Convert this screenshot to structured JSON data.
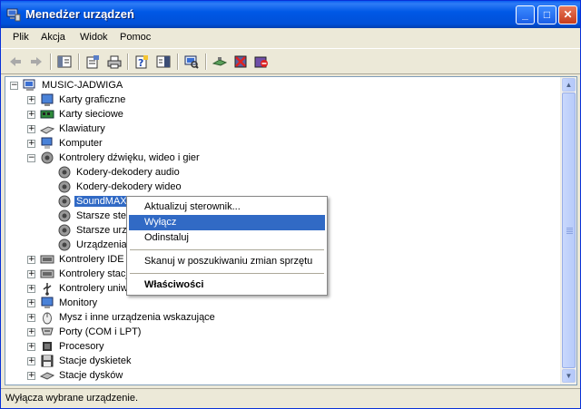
{
  "window": {
    "title": "Menedżer urządzeń"
  },
  "titlebar_buttons": {
    "minimize": "_",
    "maximize": "□",
    "close": "✕"
  },
  "menu": [
    "Plik",
    "Akcja",
    "Widok",
    "Pomoc"
  ],
  "toolbar": [
    "back-icon",
    "forward-icon",
    "console-tree-icon",
    "properties-icon",
    "print-icon",
    "help-icon",
    "view-icon",
    "scan-hardware-icon",
    "update-driver-icon",
    "uninstall-icon",
    "disable-icon"
  ],
  "tree": {
    "root": "MUSIC-JADWIGA",
    "items": [
      {
        "label": "Karty graficzne",
        "icon": "display-adapter-icon"
      },
      {
        "label": "Karty sieciowe",
        "icon": "network-adapter-icon"
      },
      {
        "label": "Klawiatury",
        "icon": "keyboard-icon"
      },
      {
        "label": "Komputer",
        "icon": "computer-icon"
      },
      {
        "label": "Kontrolery dźwięku, wideo i gier",
        "icon": "sound-controller-icon"
      },
      {
        "label": "Kodery-dekodery audio",
        "icon": "audio-codec-icon"
      },
      {
        "label": "Kodery-dekodery wideo",
        "icon": "video-codec-icon"
      },
      {
        "label": "SoundMAX Integrated Digital Audio",
        "icon": "soundmax-icon"
      },
      {
        "label": "Starsze sterowniki audio",
        "icon": "legacy-audio-icon"
      },
      {
        "label": "Starsze urządzenia do przechwytywania wideo",
        "icon": "legacy-video-icon"
      },
      {
        "label": "Urządzenia sterujące multimediów",
        "icon": "media-control-icon"
      },
      {
        "label": "Kontrolery IDE ATA/ATAPI",
        "icon": "ide-controller-icon"
      },
      {
        "label": "Kontrolery stacji dyskietek",
        "icon": "floppy-controller-icon"
      },
      {
        "label": "Kontrolery uniwersalnej magistrali szeregowej",
        "icon": "usb-controller-icon"
      },
      {
        "label": "Monitory",
        "icon": "monitor-icon"
      },
      {
        "label": "Mysz i inne urządzenia wskazujące",
        "icon": "mouse-icon"
      },
      {
        "label": "Porty (COM i LPT)",
        "icon": "ports-icon"
      },
      {
        "label": "Procesory",
        "icon": "processor-icon"
      },
      {
        "label": "Stacje dyskietek",
        "icon": "floppy-drive-icon"
      },
      {
        "label": "Stacje dysków",
        "icon": "disk-drive-icon"
      }
    ]
  },
  "context_menu": {
    "items": [
      "Aktualizuj sterownik...",
      "Wyłącz",
      "Odinstaluj",
      "Skanuj w poszukiwaniu zmian sprzętu",
      "Właściwości"
    ]
  },
  "status": "Wyłącza wybrane urządzenie.",
  "colors": {
    "title_blue": "#0054e3",
    "selection": "#316ac5",
    "window_bg": "#ece9d8"
  }
}
